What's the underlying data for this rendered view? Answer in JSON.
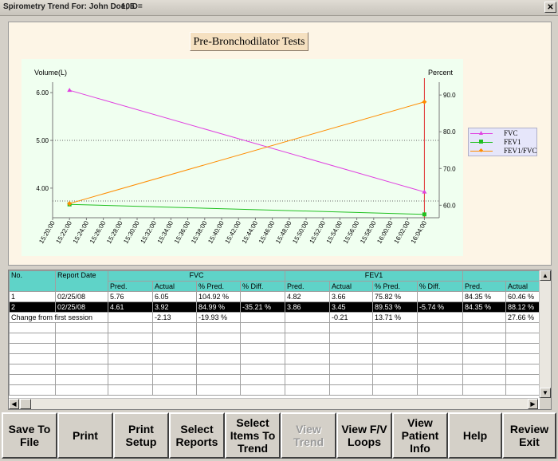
{
  "window": {
    "title_label": "Spirometry Trend For: John Doe, ID=",
    "patient_id": "105",
    "close_glyph": "✕"
  },
  "chart_data": {
    "type": "line",
    "title": "Pre-Bronchodilator Tests",
    "ylabel_left": "Volume(L)",
    "ylabel_right": "Percent",
    "x_ticks": [
      "15:20:00",
      "15:22:00",
      "15:24:00",
      "15:26:00",
      "15:28:00",
      "15:30:00",
      "15:32:00",
      "15:34:00",
      "15:36:00",
      "15:38:00",
      "15:40:00",
      "15:42:00",
      "15:44:00",
      "15:46:00",
      "15:48:00",
      "15:50:00",
      "15:52:00",
      "15:54:00",
      "15:56:00",
      "15:58:00",
      "16:00:00",
      "16:02:00",
      "16:04:00"
    ],
    "y_left_ticks": [
      "6.00",
      "5.00",
      "4.00"
    ],
    "y_right_ticks": [
      "90.0",
      "80.0",
      "70.0",
      "60.0"
    ],
    "ylim_left": [
      3.38,
      6.22
    ],
    "ylim_right": [
      56.6,
      93.5
    ],
    "x_range": [
      "15:20:00",
      "16:05:00"
    ],
    "series": [
      {
        "name": "FVC",
        "axis": "left",
        "color": "#e040e0",
        "marker": "triangle",
        "x": [
          "15:22:00",
          "16:04:00"
        ],
        "values": [
          6.05,
          3.92
        ]
      },
      {
        "name": "FEV1",
        "axis": "left",
        "color": "#20c020",
        "marker": "square",
        "x": [
          "15:22:00",
          "16:04:00"
        ],
        "values": [
          3.66,
          3.45
        ]
      },
      {
        "name": "FEV1/FVC",
        "axis": "right",
        "color": "#ff8c00",
        "marker": "diamond",
        "x": [
          "15:22:00",
          "16:04:00"
        ],
        "values": [
          60.46,
          88.12
        ]
      }
    ],
    "marker_line": {
      "x": "16:04:00",
      "color": "#e03030"
    },
    "reference_lines": [
      {
        "axis": "left",
        "value": 5.0
      },
      {
        "axis": "left",
        "value": 3.73
      }
    ],
    "grid": false,
    "legend_position": "right"
  },
  "table": {
    "top_headers": [
      "No.",
      "Report Date",
      "FVC",
      "FEV1",
      ""
    ],
    "sub_headers": [
      "Pred.",
      "Actual",
      "% Pred.",
      "% Diff.",
      "Pred.",
      "Actual",
      "% Pred.",
      "% Diff.",
      "Pred.",
      "Actual"
    ],
    "rows": [
      [
        "1",
        "02/25/08",
        "5.76",
        "6.05",
        "104.92 %",
        "",
        "4.82",
        "3.66",
        "75.82 %",
        "",
        "84.35 %",
        "60.46 %"
      ],
      [
        "2",
        "02/25/08",
        "4.61",
        "3.92",
        "84.99 %",
        "-35.21 %",
        "3.86",
        "3.45",
        "89.53 %",
        "-5.74 %",
        "84.35 %",
        "88.12 %"
      ],
      [
        "Change from first session",
        "",
        "",
        "-2.13",
        "-19.93 %",
        "",
        "",
        "-0.21",
        "13.71 %",
        "",
        "",
        "27.66 %"
      ]
    ],
    "selected_row": 1
  },
  "buttons": [
    {
      "label": "Save To\nFile",
      "enabled": true
    },
    {
      "label": "Print",
      "enabled": true
    },
    {
      "label": "Print\nSetup",
      "enabled": true
    },
    {
      "label": "Select\nReports",
      "enabled": true
    },
    {
      "label": "Select\nItems To\nTrend",
      "enabled": true
    },
    {
      "label": "View\nTrend",
      "enabled": false
    },
    {
      "label": "View F/V\nLoops",
      "enabled": true
    },
    {
      "label": "View\nPatient\nInfo",
      "enabled": true
    },
    {
      "label": "Help",
      "enabled": true
    },
    {
      "label": "Review\nExit",
      "enabled": true
    }
  ],
  "scrollbar_glyphs": {
    "left": "◀",
    "right": "▶",
    "up": "▲",
    "down": "▼"
  },
  "icons": [
    "close-icon",
    "scroll-left-icon",
    "scroll-right-icon",
    "scroll-up-icon",
    "scroll-down-icon"
  ]
}
